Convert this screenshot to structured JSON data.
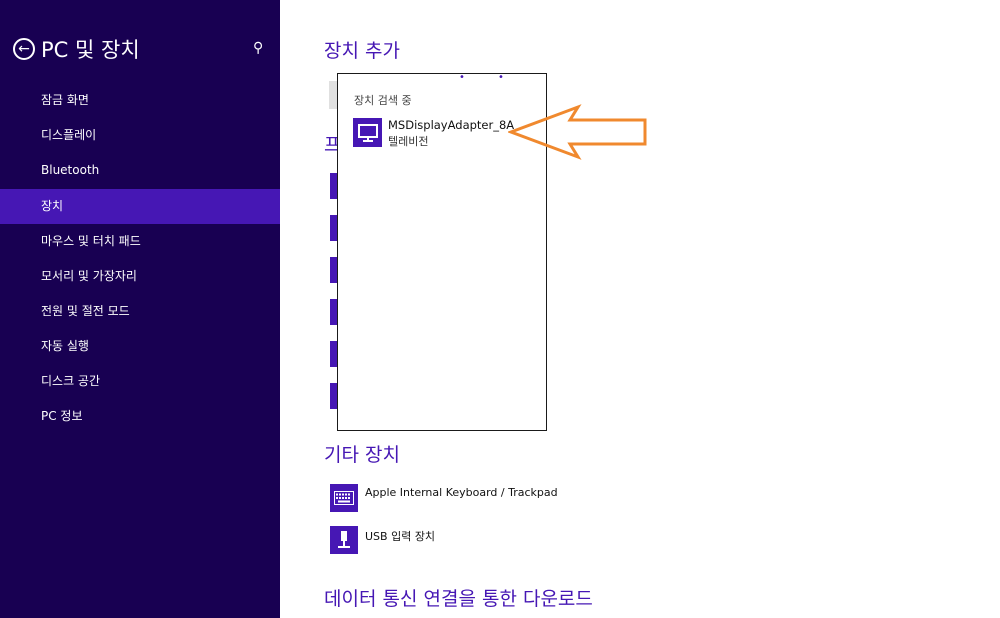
{
  "sidebar": {
    "title": "PC 및 장치",
    "items": [
      {
        "label": "잠금 화면",
        "active": false
      },
      {
        "label": "디스플레이",
        "active": false
      },
      {
        "label": "Bluetooth",
        "active": false
      },
      {
        "label": "장치",
        "active": true
      },
      {
        "label": "마우스 및 터치 패드",
        "active": false
      },
      {
        "label": "모서리 및 가장자리",
        "active": false
      },
      {
        "label": "전원 및 절전 모드",
        "active": false
      },
      {
        "label": "자동 실행",
        "active": false
      },
      {
        "label": "디스크 공간",
        "active": false
      },
      {
        "label": "PC 정보",
        "active": false
      }
    ]
  },
  "main": {
    "add_device_heading": "장치 추가",
    "printers_heading_partial": "프",
    "other_devices_heading": "기타 장치",
    "other_devices": [
      {
        "label": "Apple Internal Keyboard / Trackpad",
        "icon": "keyboard-icon"
      },
      {
        "label": "USB 입력 장치",
        "icon": "usb-device-icon"
      }
    ],
    "metered_heading": "데이터 통신 연결을 통한 다운로드"
  },
  "popup": {
    "status": "장치 검색 중",
    "found_device": {
      "name": "MSDisplayAdapter_8A",
      "type": "텔레비전",
      "icon": "monitor-icon"
    }
  },
  "colors": {
    "sidebar_bg": "#180052",
    "accent": "#4617b4",
    "annotation_arrow": "#f0892e"
  }
}
